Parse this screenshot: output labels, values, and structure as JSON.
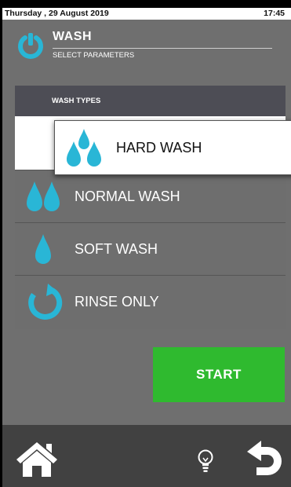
{
  "statusbar": {
    "date": "Thursday , 29 August 2019",
    "time": "17:45"
  },
  "header": {
    "title": "WASH",
    "subtitle": "SELECT PARAMETERS",
    "icon": "power-icon"
  },
  "wash_types": {
    "heading": "WASH TYPES",
    "selected": "HARD WASH",
    "items": [
      {
        "label": "HARD WASH",
        "icon": "triple-drop-icon"
      },
      {
        "label": "NORMAL WASH",
        "icon": "double-drop-icon"
      },
      {
        "label": "SOFT WASH",
        "icon": "single-drop-icon"
      },
      {
        "label": "RINSE ONLY",
        "icon": "rinse-icon"
      }
    ]
  },
  "start_button": {
    "label": "START"
  },
  "footer": {
    "home_icon": "home-icon",
    "tip_icon": "lightbulb-icon",
    "back_icon": "back-icon"
  },
  "colors": {
    "accent": "#29b6d6",
    "start": "#2fba2f",
    "background": "#6f6f6f",
    "footer": "#414141"
  }
}
